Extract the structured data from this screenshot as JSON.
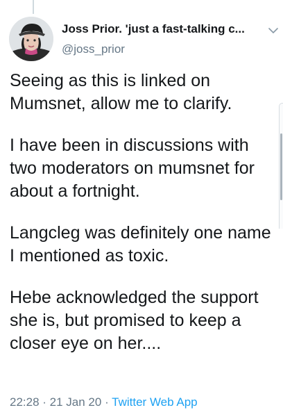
{
  "author": {
    "display_name": "Joss Prior. 'just a fast-talking c...",
    "handle": "@joss_prior"
  },
  "tweet": {
    "paragraphs": [
      "Seeing as this is linked on Mumsnet, allow me to clarify.",
      "I have been in discussions with two moderators on mumsnet for about a fortnight.",
      "Langcleg was definitely one name I mentioned as toxic.",
      "Hebe acknowledged the support she is, but promised to keep a closer eye on her...."
    ],
    "time": "22:28",
    "date": "21 Jan 20",
    "separator": " · ",
    "source": "Twitter Web App"
  },
  "icons": {
    "menu": "chevron-down-icon",
    "avatar": "profile-photo"
  },
  "colors": {
    "text": "#14171a",
    "secondary": "#657786",
    "link": "#1da1f2",
    "thread_line": "#cfd9de"
  }
}
